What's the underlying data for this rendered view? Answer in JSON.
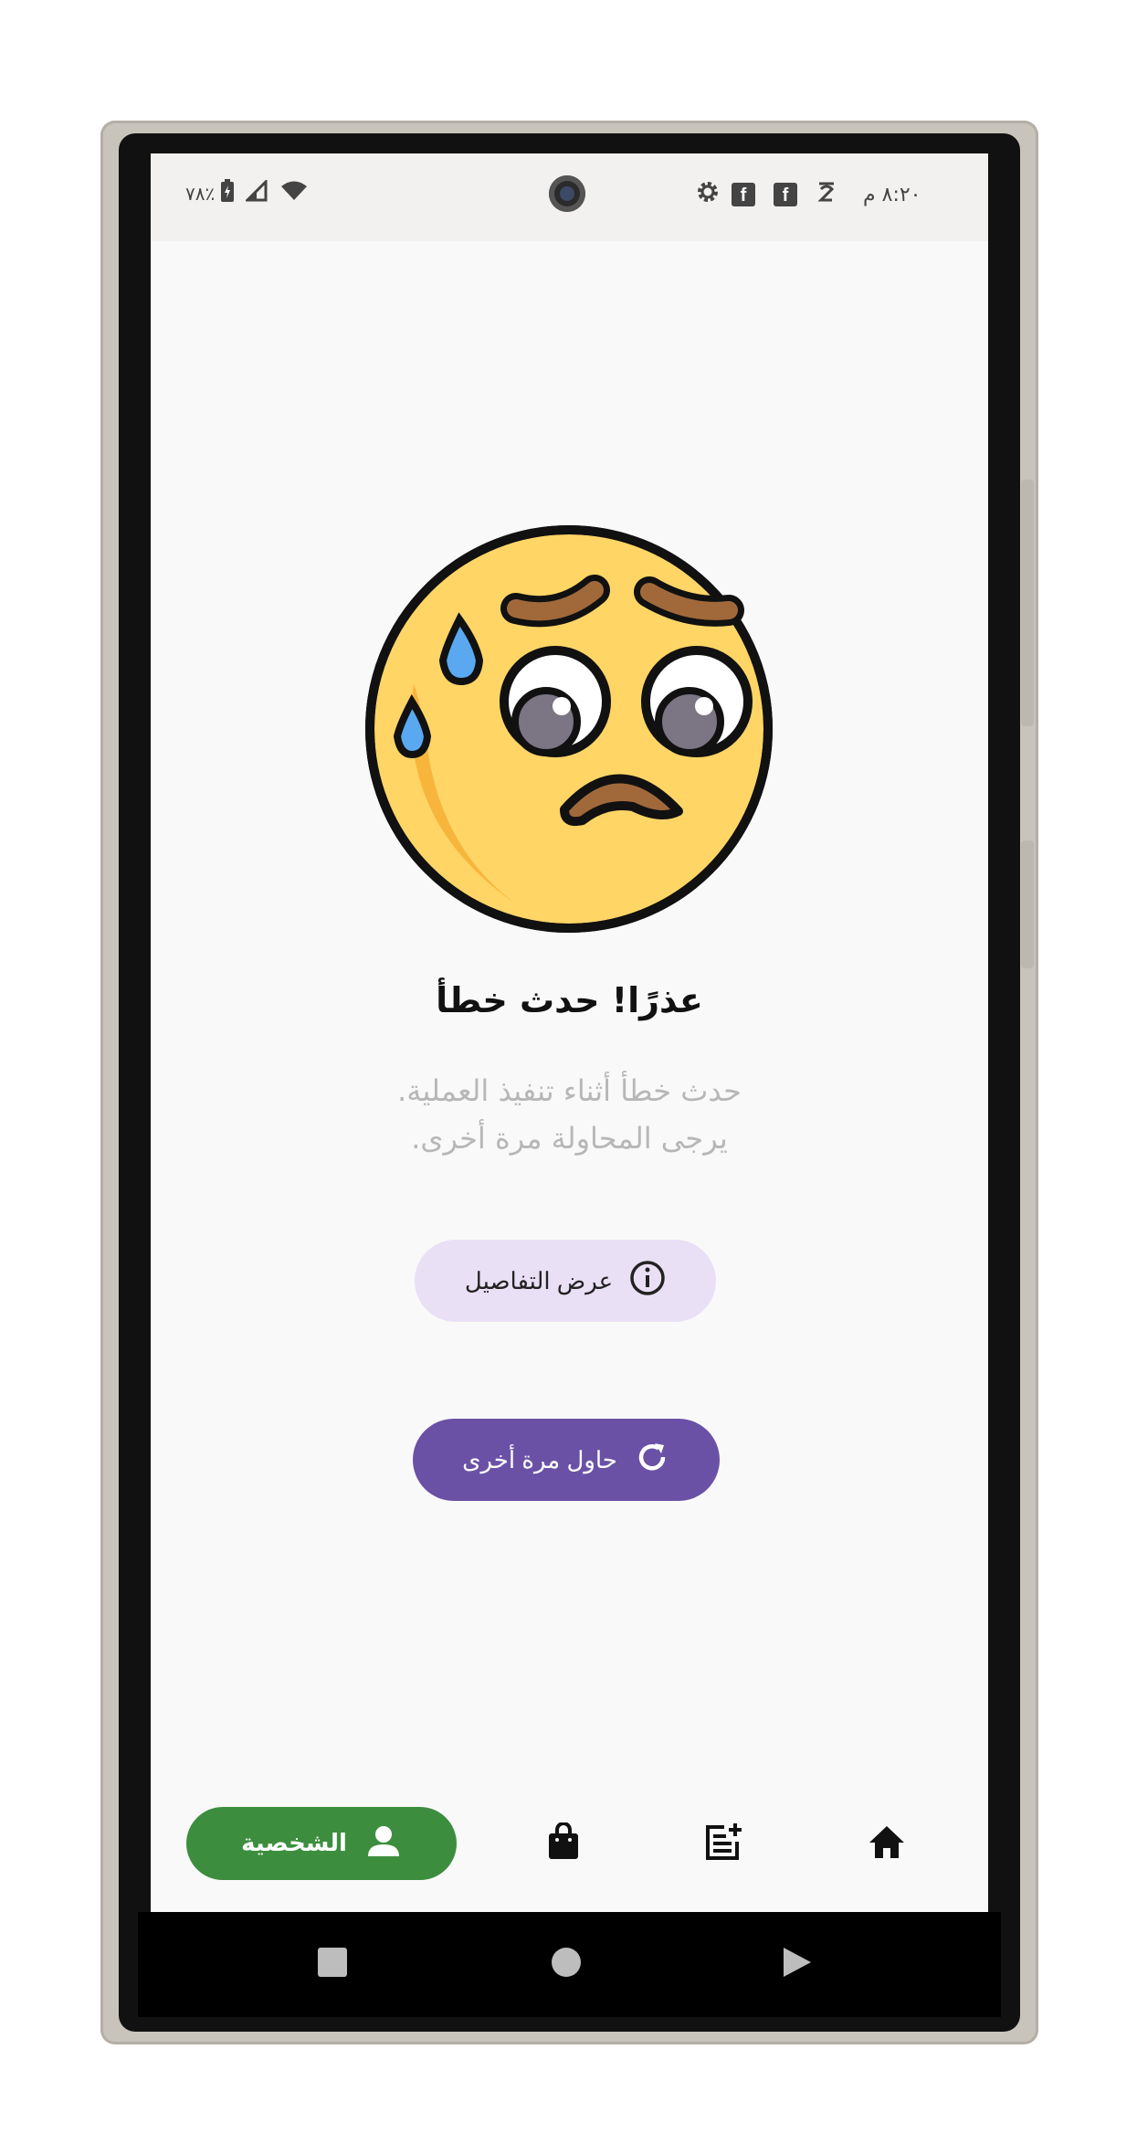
{
  "status_bar": {
    "time": "٨:٢٠ م",
    "battery": "٧٨٪",
    "icons": [
      "settings-icon",
      "facebook-icon",
      "facebook-icon",
      "notification-icon",
      "signal-icon",
      "wifi-icon",
      "battery-icon"
    ]
  },
  "error": {
    "title": "عذرًا! حدث خطأ",
    "message_line1": "حدث خطأ أثناء تنفيذ العملية.",
    "message_line2": "يرجى المحاولة مرة أخرى."
  },
  "buttons": {
    "details_label": "عرض التفاصيل",
    "retry_label": "حاول مرة أخرى"
  },
  "bottom_nav": {
    "items": [
      {
        "icon": "home-icon"
      },
      {
        "icon": "post-add-icon"
      },
      {
        "icon": "shopping-bag-icon"
      },
      {
        "icon": "person-icon",
        "label": "الشخصية",
        "active": true
      }
    ]
  },
  "colors": {
    "accent_purple": "#6a51a6",
    "details_bg": "#e9e0f6",
    "active_green": "#3c8e3e"
  }
}
